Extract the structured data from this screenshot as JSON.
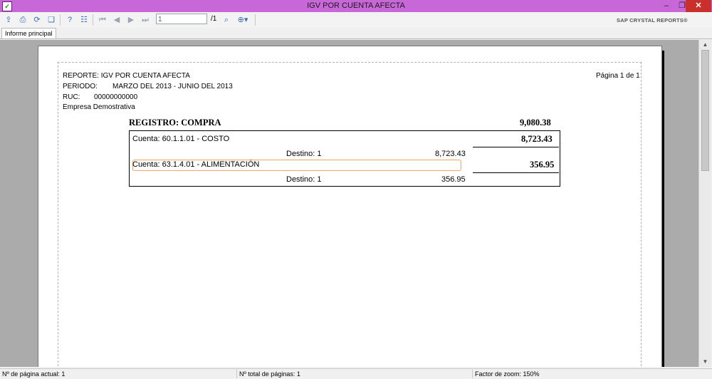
{
  "window": {
    "title": "IGV POR CUENTA AFECTA",
    "min_glyph": "–",
    "restore_glyph": "❐",
    "close_glyph": "✕",
    "app_icon": "crystal-reports-icon"
  },
  "toolbar": {
    "page_input_value": "1",
    "page_total": "/1",
    "brand": "SAP CRYSTAL REPORTS®"
  },
  "tabs": [
    {
      "label": "Informe principal"
    }
  ],
  "report": {
    "line1": "REPORTE: IGV POR CUENTA AFECTA",
    "periodo_label": "PERIODO:",
    "periodo_value": "MARZO DEL 2013 - JUNIO DEL 2013",
    "ruc_label": "RUC:",
    "ruc_value": "00000000000",
    "empresa": "Empresa Demostrativa",
    "page_info": "Página 1 de 1",
    "registro_label": "REGISTRO: COMPRA",
    "registro_total": "9,080.38",
    "cuentas": [
      {
        "label": "Cuenta: 60.1.1.01 - COSTO",
        "total": "8,723.43",
        "destino": "Destino: 1",
        "destino_amount": "8,723.43"
      },
      {
        "label": "Cuenta: 63.1.4.01 - ALIMENTACIÓN",
        "total": "356.95",
        "destino": "Destino: 1",
        "destino_amount": "356.95"
      }
    ]
  },
  "status": {
    "current_page": "Nº de página actual: 1",
    "total_pages": "Nº total de páginas: 1",
    "zoom": "Factor de zoom: 150%"
  }
}
